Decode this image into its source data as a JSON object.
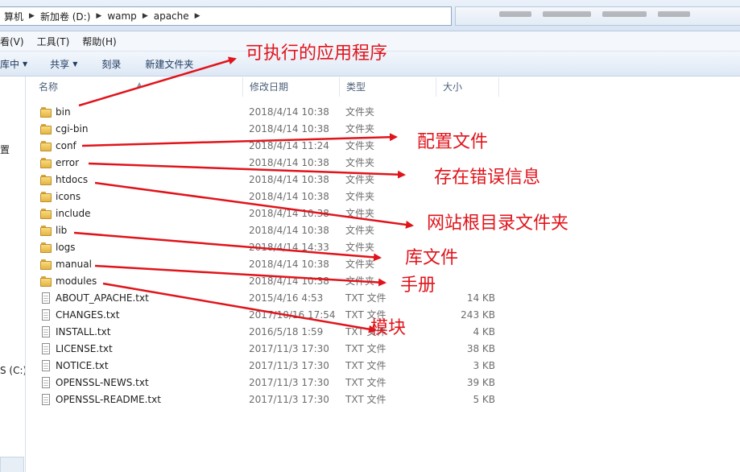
{
  "address": {
    "crumbs": [
      "算机",
      "新加卷 (D:)",
      "wamp",
      "apache"
    ]
  },
  "menubar": {
    "items": [
      "看(V)",
      "工具(T)",
      "帮助(H)"
    ]
  },
  "toolbar": {
    "buttons": [
      "库中",
      "共享",
      "刻录",
      "新建文件夹"
    ]
  },
  "navpane": {
    "items": [
      "置",
      "S (C:)"
    ]
  },
  "columns": {
    "name": "名称",
    "date": "修改日期",
    "type": "类型",
    "size": "大小"
  },
  "files": [
    {
      "name": "bin",
      "date": "2018/4/14 10:38",
      "type": "文件夹",
      "size": "",
      "icon": "folder-icon"
    },
    {
      "name": "cgi-bin",
      "date": "2018/4/14 10:38",
      "type": "文件夹",
      "size": "",
      "icon": "folder-icon"
    },
    {
      "name": "conf",
      "date": "2018/4/14 11:24",
      "type": "文件夹",
      "size": "",
      "icon": "folder-icon"
    },
    {
      "name": "error",
      "date": "2018/4/14 10:38",
      "type": "文件夹",
      "size": "",
      "icon": "folder-icon"
    },
    {
      "name": "htdocs",
      "date": "2018/4/14 10:38",
      "type": "文件夹",
      "size": "",
      "icon": "folder-icon"
    },
    {
      "name": "icons",
      "date": "2018/4/14 10:38",
      "type": "文件夹",
      "size": "",
      "icon": "folder-icon"
    },
    {
      "name": "include",
      "date": "2018/4/14 10:38",
      "type": "文件夹",
      "size": "",
      "icon": "folder-icon"
    },
    {
      "name": "lib",
      "date": "2018/4/14 10:38",
      "type": "文件夹",
      "size": "",
      "icon": "folder-icon"
    },
    {
      "name": "logs",
      "date": "2018/4/14 14:33",
      "type": "文件夹",
      "size": "",
      "icon": "folder-icon"
    },
    {
      "name": "manual",
      "date": "2018/4/14 10:38",
      "type": "文件夹",
      "size": "",
      "icon": "folder-icon"
    },
    {
      "name": "modules",
      "date": "2018/4/14 10:38",
      "type": "文件夹",
      "size": "",
      "icon": "folder-icon"
    },
    {
      "name": "ABOUT_APACHE.txt",
      "date": "2015/4/16 4:53",
      "type": "TXT 文件",
      "size": "14 KB",
      "icon": "text-file-icon"
    },
    {
      "name": "CHANGES.txt",
      "date": "2017/10/16 17:54",
      "type": "TXT 文件",
      "size": "243 KB",
      "icon": "text-file-icon"
    },
    {
      "name": "INSTALL.txt",
      "date": "2016/5/18 1:59",
      "type": "TXT 文件",
      "size": "4 KB",
      "icon": "text-file-icon"
    },
    {
      "name": "LICENSE.txt",
      "date": "2017/11/3 17:30",
      "type": "TXT 文件",
      "size": "38 KB",
      "icon": "text-file-icon"
    },
    {
      "name": "NOTICE.txt",
      "date": "2017/11/3 17:30",
      "type": "TXT 文件",
      "size": "3 KB",
      "icon": "text-file-icon"
    },
    {
      "name": "OPENSSL-NEWS.txt",
      "date": "2017/11/3 17:30",
      "type": "TXT 文件",
      "size": "39 KB",
      "icon": "text-file-icon"
    },
    {
      "name": "OPENSSL-README.txt",
      "date": "2017/11/3 17:30",
      "type": "TXT 文件",
      "size": "5 KB",
      "icon": "text-file-icon"
    }
  ],
  "annotations": {
    "bin": "可执行的应用程序",
    "conf": "配置文件",
    "error": "存在错误信息",
    "htdocs": "网站根目录文件夹",
    "lib": "库文件",
    "manual": "手册",
    "modules": "模块"
  },
  "colors": {
    "annotation": "#e0141b",
    "folder": "#e6b443",
    "toolbar": "#dde8f5"
  }
}
